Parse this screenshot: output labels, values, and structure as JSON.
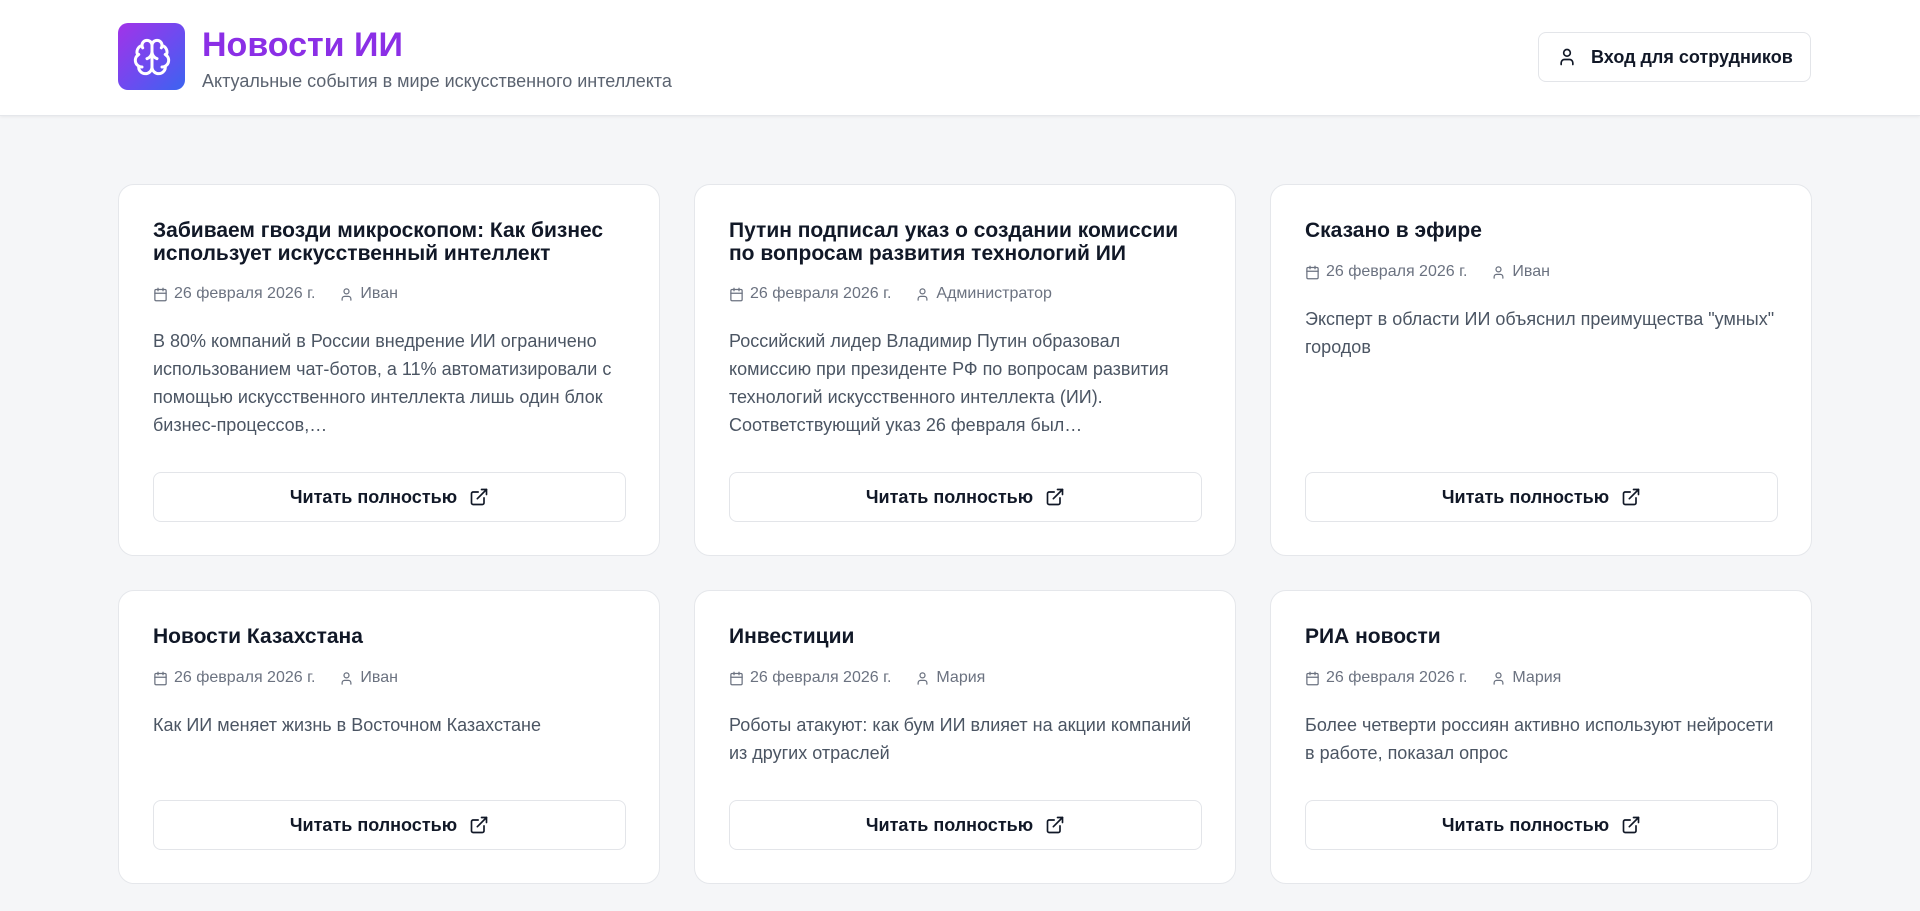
{
  "header": {
    "title": "Новости ИИ",
    "subtitle": "Актуальные события в мире искусственного интеллекта",
    "login_label": "Вход для сотрудников",
    "logo_icon": "brain-icon",
    "accent": "#8b2fe6"
  },
  "cards": [
    {
      "title": "Забиваем гвозди микроскопом: Как бизнес использует искусственный интеллект",
      "date": "26 февраля 2026 г.",
      "author": "Иван",
      "excerpt": "В 80% компаний в России внедрение ИИ ограничено использованием чат-ботов, а 11% автоматизировали с помощью искусственного интеллекта лишь один блок бизнес-процессов,…",
      "read_label": "Читать полностью"
    },
    {
      "title": "Путин подписал указ о создании комиссии по вопросам развития технологий ИИ",
      "date": "26 февраля 2026 г.",
      "author": "Администратор",
      "excerpt": "Российский лидер Владимир Путин образовал комиссию при президенте РФ по вопросам развития технологий искусственного интеллекта (ИИ). Соответствующий указ 26 февраля был…",
      "read_label": "Читать полностью"
    },
    {
      "title": "Сказано в эфире",
      "date": "26 февраля 2026 г.",
      "author": "Иван",
      "excerpt": "Эксперт в области ИИ объяснил преимущества \"умных\" городов",
      "read_label": "Читать полностью"
    },
    {
      "title": "Новости Казахстана",
      "date": "26 февраля 2026 г.",
      "author": "Иван",
      "excerpt": "Как ИИ меняет жизнь в Восточном Казахстане",
      "read_label": "Читать полностью"
    },
    {
      "title": "Инвестиции",
      "date": "26 февраля 2026 г.",
      "author": "Мария",
      "excerpt": "Роботы атакуют: как бум ИИ влияет на акции компаний из других отраслей",
      "read_label": "Читать полностью"
    },
    {
      "title": "РИА новости",
      "date": "26 февраля 2026 г.",
      "author": "Мария",
      "excerpt": "Более четверти россиян активно используют нейросети в работе, показал опрос",
      "read_label": "Читать полностью"
    }
  ]
}
